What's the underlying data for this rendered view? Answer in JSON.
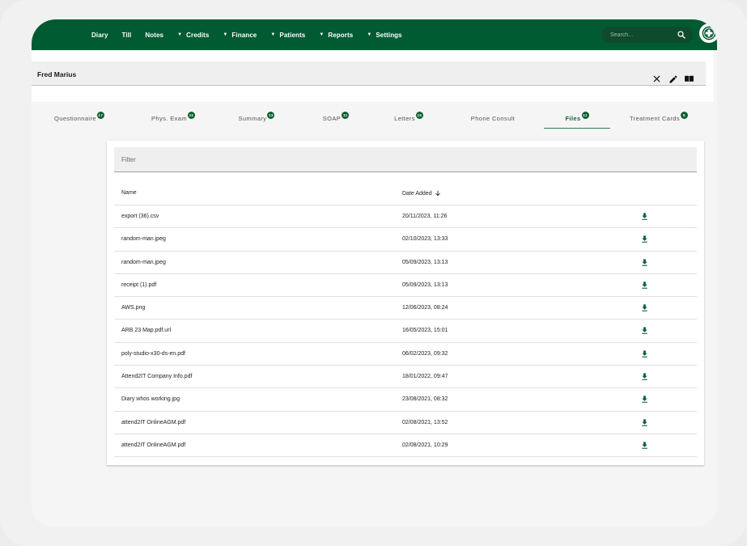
{
  "nav": {
    "items": [
      {
        "label": "Diary",
        "dropdown": false
      },
      {
        "label": "Till",
        "dropdown": false
      },
      {
        "label": "Notes",
        "dropdown": false
      },
      {
        "label": "Credits",
        "dropdown": true
      },
      {
        "label": "Finance",
        "dropdown": true
      },
      {
        "label": "Patients",
        "dropdown": true
      },
      {
        "label": "Reports",
        "dropdown": true
      },
      {
        "label": "Settings",
        "dropdown": true
      }
    ],
    "search_placeholder": "Search...",
    "colors": {
      "bar": "#005a32",
      "accent": "#0c5f2f"
    }
  },
  "patient": {
    "name": "Fred Marius"
  },
  "tabs": [
    {
      "label": "Questionnaire",
      "badge": "17"
    },
    {
      "label": "Phys. Exam",
      "badge": "11"
    },
    {
      "label": "Summary",
      "badge": "13"
    },
    {
      "label": "SOAP",
      "badge": "11"
    },
    {
      "label": "Letters",
      "badge": "15"
    },
    {
      "label": "Phone Consult",
      "badge": ""
    },
    {
      "label": "Files",
      "badge": "11"
    },
    {
      "label": "Treatment Cards",
      "badge": "5"
    }
  ],
  "active_tab": "Files",
  "files": {
    "filter_placeholder": "Filter",
    "columns": {
      "name": "Name",
      "date": "Date Added"
    },
    "rows": [
      {
        "name": "export (36).csv",
        "date": "20/11/2023, 11:26"
      },
      {
        "name": "random-man.jpeg",
        "date": "02/10/2023, 13:33"
      },
      {
        "name": "random-man.jpeg",
        "date": "05/09/2023, 13:13"
      },
      {
        "name": "receipt (1).pdf",
        "date": "05/09/2023, 13:13"
      },
      {
        "name": "AWS.png",
        "date": "12/06/2023, 08:24"
      },
      {
        "name": "ARB 23 Map.pdf.url",
        "date": "16/05/2023, 15:01"
      },
      {
        "name": "poly-studio-x30-ds-en.pdf",
        "date": "06/02/2023, 09:32"
      },
      {
        "name": "Attend2IT Company Info.pdf",
        "date": "18/01/2022, 09:47"
      },
      {
        "name": "Diary whos working.jpg",
        "date": "23/08/2021, 08:32"
      },
      {
        "name": "attend2IT OnlineAGM.pdf",
        "date": "02/08/2021, 13:52"
      },
      {
        "name": "attend2IT OnlineAGM.pdf",
        "date": "02/08/2021, 10:29"
      }
    ]
  }
}
